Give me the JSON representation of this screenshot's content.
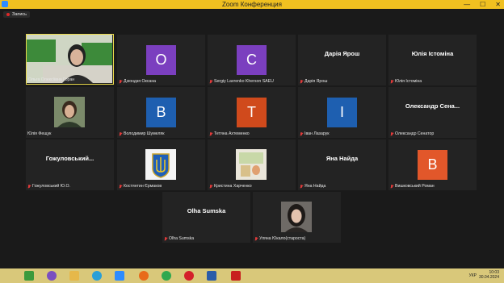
{
  "window": {
    "title": "Zoom Конференция"
  },
  "recording": {
    "label": "Запись"
  },
  "participants": [
    {
      "name": "Ольга Олексіївна Горан",
      "type": "video",
      "active": true
    },
    {
      "name": "Дзюндзя Оксана",
      "type": "letter",
      "letter": "O",
      "color": "#7b3fbf"
    },
    {
      "name": "Sergiy Lavrenko Kherson SAEU",
      "type": "letter",
      "letter": "C",
      "color": "#7b3fbf"
    },
    {
      "name": "Дарія Ярош",
      "type": "name",
      "display": "Дарія Ярош"
    },
    {
      "name": "Юлія Істоміна",
      "type": "name",
      "display": "Юлія Істоміна"
    },
    {
      "name": "Юлія Фещук",
      "type": "video"
    },
    {
      "name": "Володимир Шумеляк",
      "type": "letter",
      "letter": "B",
      "color": "#1e5fb0"
    },
    {
      "name": "Тетяна Ахтеменко",
      "type": "letter",
      "letter": "T",
      "color": "#d04a1c"
    },
    {
      "name": "Іван Лазарук",
      "type": "letter",
      "letter": "I",
      "color": "#1e5fb0"
    },
    {
      "name": "Олександр Сенатор",
      "type": "name",
      "display": "Олександр Сена..."
    },
    {
      "name": "Гожуловський Ю.О.",
      "type": "name",
      "display": "Гожуловський..."
    },
    {
      "name": "Костянтин Єрмаков",
      "type": "image"
    },
    {
      "name": "Кристина Харченко",
      "type": "image"
    },
    {
      "name": "Яна Найда",
      "type": "name",
      "display": "Яна Найда"
    },
    {
      "name": "Вишковський Роман",
      "type": "letter",
      "letter": "B",
      "color": "#e2572a"
    },
    {
      "name": "Olha Sumska",
      "type": "name",
      "display": "Olha Sumska"
    },
    {
      "name": "Уляна Юкало(староста)",
      "type": "video"
    }
  ],
  "taskbar": {
    "language": "УКР",
    "time": "10:03",
    "date": "30.04.2024"
  }
}
